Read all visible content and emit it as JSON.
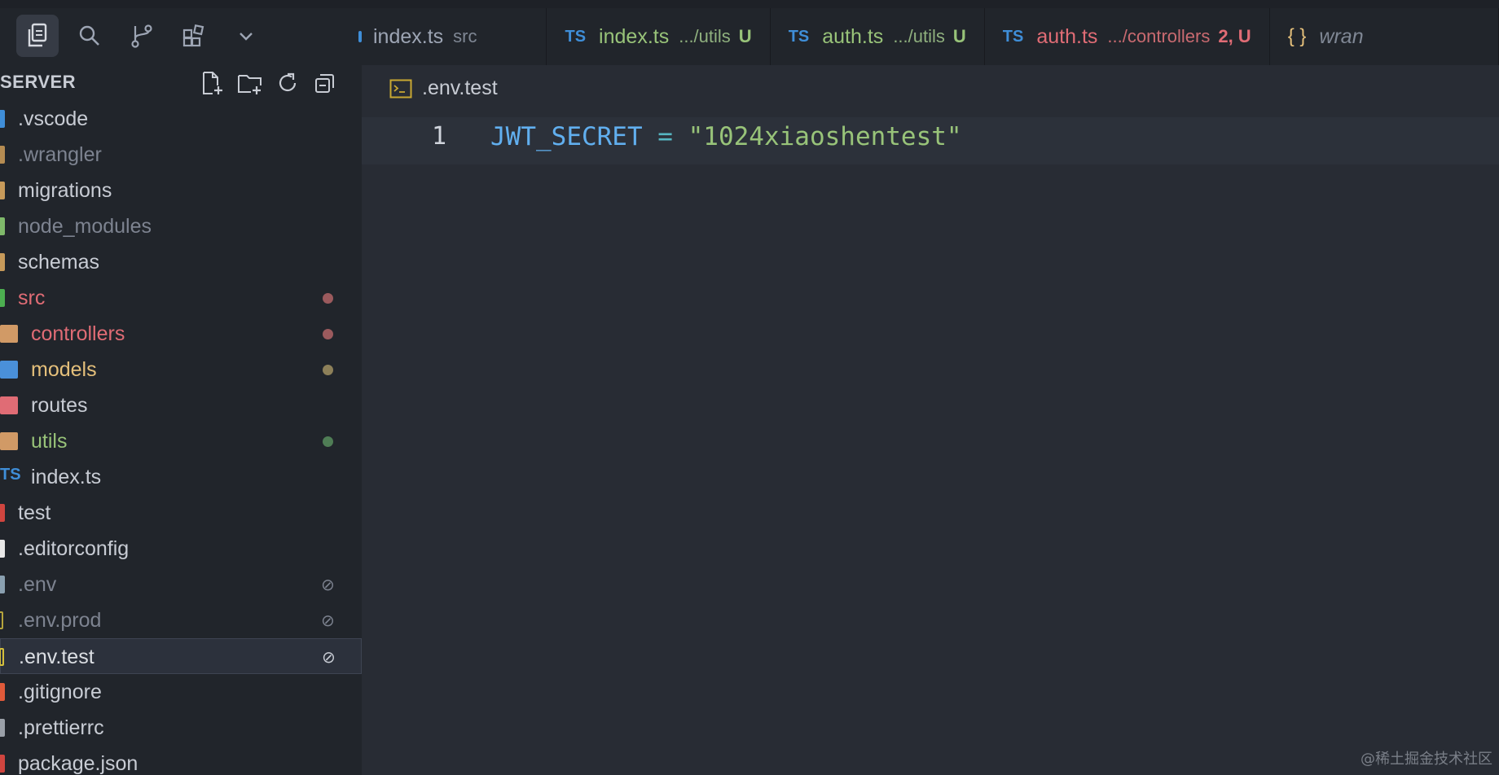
{
  "tabs": [
    {
      "lang": "",
      "name": "index.ts",
      "desc": "src",
      "status": "",
      "name_color": "#9da5b4",
      "desc_color": "#7f8794",
      "status_color": ""
    },
    {
      "lang": "TS",
      "name": "index.ts",
      "desc": ".../utils",
      "status": "U",
      "name_color": "#98c379",
      "desc_color": "#8fb07e",
      "status_color": "#98c379"
    },
    {
      "lang": "TS",
      "name": "auth.ts",
      "desc": ".../utils",
      "status": "U",
      "name_color": "#98c379",
      "desc_color": "#8fb07e",
      "status_color": "#98c379"
    },
    {
      "lang": "TS",
      "name": "auth.ts",
      "desc": ".../controllers",
      "status": "2, U",
      "name_color": "#e06c75",
      "desc_color": "#c96a70",
      "status_color": "#e06c75"
    },
    {
      "lang": "{ }",
      "name": "wran",
      "desc": "",
      "status": "",
      "name_color": "#7f8794",
      "desc_color": "",
      "status_color": ""
    }
  ],
  "sidebar": {
    "title": "SERVER",
    "items": [
      {
        "label": ".vscode",
        "depth": 0,
        "color": "#c8ccd4",
        "icon_color": "#3f8ed8",
        "decoration": ""
      },
      {
        "label": ".wrangler",
        "depth": 0,
        "color": "#7d8390",
        "icon_color": "#b58c52",
        "decoration": ""
      },
      {
        "label": "migrations",
        "depth": 0,
        "color": "#c8ccd4",
        "icon_color": "#c79a5a",
        "decoration": ""
      },
      {
        "label": "node_modules",
        "depth": 0,
        "color": "#7d8390",
        "icon_color": "#7fb96a",
        "decoration": ""
      },
      {
        "label": "schemas",
        "depth": 0,
        "color": "#c8ccd4",
        "icon_color": "#c79a5a",
        "decoration": ""
      },
      {
        "label": "src",
        "depth": 0,
        "color": "#e06c75",
        "icon_color": "#4caf50",
        "decoration": "dot",
        "dot_color": "#9b5a5d"
      },
      {
        "label": "controllers",
        "depth": 1,
        "color": "#e06c75",
        "icon_color": "#d19a66",
        "decoration": "dot",
        "dot_color": "#9b5a5d"
      },
      {
        "label": "models",
        "depth": 1,
        "color": "#e5c07b",
        "icon_color": "#4a90d9",
        "decoration": "dot",
        "dot_color": "#8d8059"
      },
      {
        "label": "routes",
        "depth": 1,
        "color": "#c8ccd4",
        "icon_color": "#e06c75",
        "decoration": ""
      },
      {
        "label": "utils",
        "depth": 1,
        "color": "#98c379",
        "icon_color": "#d19a66",
        "decoration": "dot",
        "dot_color": "#4f7d55"
      },
      {
        "label": "index.ts",
        "depth": 1,
        "color": "#c8ccd4",
        "icon_color": "#3f8ed8",
        "decoration": "",
        "icon_text": "TS"
      },
      {
        "label": "test",
        "depth": 0,
        "color": "#c8ccd4",
        "icon_color": "#d0453f",
        "decoration": ""
      },
      {
        "label": ".editorconfig",
        "depth": 0,
        "color": "#c8ccd4",
        "icon_color": "#e8e8e8",
        "decoration": ""
      },
      {
        "label": ".env",
        "depth": 0,
        "color": "#7d8390",
        "icon_color": "#8aa0b0",
        "decoration": "ignored"
      },
      {
        "label": ".env.prod",
        "depth": 0,
        "color": "#7d8390",
        "icon_color": "#b5a43c",
        "decoration": "ignored"
      },
      {
        "label": ".env.test",
        "depth": 0,
        "color": "#dcdfe4",
        "icon_color": "#d4bf3c",
        "decoration": "ignored",
        "selected": true
      },
      {
        "label": ".gitignore",
        "depth": 0,
        "color": "#c8ccd4",
        "icon_color": "#e05a3a",
        "decoration": ""
      },
      {
        "label": ".prettierrc",
        "depth": 0,
        "color": "#c8ccd4",
        "icon_color": "#9aa0a8",
        "decoration": ""
      },
      {
        "label": "package.json",
        "depth": 0,
        "color": "#c8ccd4",
        "icon_color": "#d0453f",
        "decoration": ""
      }
    ],
    "ignored_glyph": "⊘"
  },
  "editor": {
    "breadcrumb": ".env.test",
    "line_number": "1",
    "code": {
      "key": "JWT_SECRET",
      "op": " = ",
      "value": "\"1024xiaoshentest\""
    }
  },
  "watermark": "@稀土掘金技术社区",
  "icons": {
    "explorer": "copy-files-icon",
    "search": "search-icon",
    "source_control": "source-control-icon",
    "extensions": "extensions-icon",
    "more": "chevron-down-icon"
  }
}
